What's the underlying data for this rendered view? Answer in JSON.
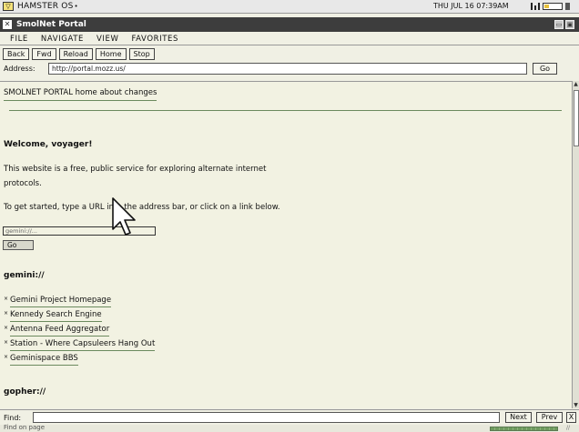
{
  "os": {
    "name": "HAMSTER OS",
    "suffix": "•",
    "clock": "THU JUL 16 07:39AM",
    "battery_level": 0.3,
    "accent": "#f6e27a"
  },
  "window": {
    "title": "SmolNet Portal",
    "close_glyph": "✕"
  },
  "menu": [
    "FILE",
    "NAVIGATE",
    "VIEW",
    "FAVORITES"
  ],
  "toolbar": {
    "back": "Back",
    "fwd": "Fwd",
    "reload": "Reload",
    "home": "Home",
    "stop": "Stop"
  },
  "address": {
    "label": "Address:",
    "value": "http://portal.mozz.us/",
    "go": "Go"
  },
  "page": {
    "nav": "SMOLNET PORTAL home about changes",
    "welcome": "Welcome, voyager!",
    "intro": "This website is a free, public service for exploring alternate internet protocols.",
    "instructions": "To get started, type a URL into the address bar, or click on a link below.",
    "search_placeholder": "gemini://...",
    "search_go": "Go",
    "gemini_heading": "gemini://",
    "gemini_links": [
      "Gemini Project Homepage",
      "Kennedy Search Engine",
      "Antenna Feed Aggregator",
      "Station - Where Capsuleers Hang Out",
      "Geminispace BBS"
    ],
    "gopher_heading": "gopher://",
    "link_color": "#6b8a5e"
  },
  "find": {
    "label": "Find:",
    "value": "",
    "next": "Next",
    "prev": "Prev",
    "close": "X"
  },
  "status": {
    "text": "Find on page",
    "progress": 1.0,
    "end": "//"
  }
}
